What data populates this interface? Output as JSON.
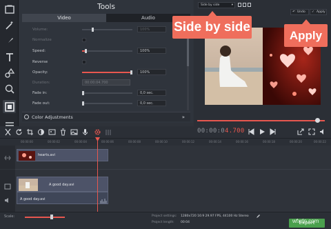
{
  "tools_panel": {
    "title": "Tools",
    "tabs": [
      {
        "label": "Video",
        "active": true
      },
      {
        "label": "Audio",
        "active": false
      }
    ],
    "properties": [
      {
        "label": "Volume:",
        "value": "100%",
        "level": 0.2,
        "enabled": false
      },
      {
        "label": "Normalize",
        "enabled": false
      },
      {
        "label": "Speed:",
        "value": "100%",
        "level": 0.07,
        "enabled": true
      },
      {
        "label": "Reverse",
        "enabled": true
      },
      {
        "label": "Opacity:",
        "value": "100%",
        "level": 1.0,
        "enabled": true
      },
      {
        "label": "Duration:",
        "value": "00:00:04.700",
        "enabled": false
      },
      {
        "label": "Fade in:",
        "value": "0,0 sec.",
        "level": 0.0,
        "enabled": true
      },
      {
        "label": "Fade out:",
        "value": "0,0 sec.",
        "level": 0.0,
        "enabled": true
      }
    ],
    "color_adjustments": "Color Adjustments"
  },
  "preview": {
    "mode_select": "Side by side",
    "undo_label": "Undo",
    "apply_label": "Apply",
    "timecode_dim": "00:00:0",
    "timecode_hi": "4.700",
    "seek_progress": 0.96
  },
  "callouts": {
    "side_by_side": "Side by side",
    "apply": "Apply"
  },
  "timeline": {
    "ruler_ticks": [
      "00:00:00",
      "00:00:02",
      "00:00:04",
      "00:00:06",
      "00:00:08",
      "00:00:10",
      "00:00:12",
      "00:00:14",
      "00:00:16",
      "00:00:18",
      "00:00:20",
      "00:00:22"
    ],
    "clips": [
      {
        "name": "hearts.avi"
      },
      {
        "name": "A good day.avi"
      },
      {
        "name": "A good day.avi"
      }
    ]
  },
  "footer": {
    "scale_label": "Scale:",
    "project_settings_label": "Project settings:",
    "project_settings_value": "1280x720 16:9 29.97 FPS, 44100 Hz Stereo",
    "project_length_label": "Project length:",
    "project_length_value": "00:04",
    "export_label": "Export"
  },
  "watermark": "wfxdn.com",
  "colors": {
    "accent": "#e8574f",
    "callout": "#ef6e5c",
    "export": "#4aa04d",
    "clip": "#4d5368"
  }
}
